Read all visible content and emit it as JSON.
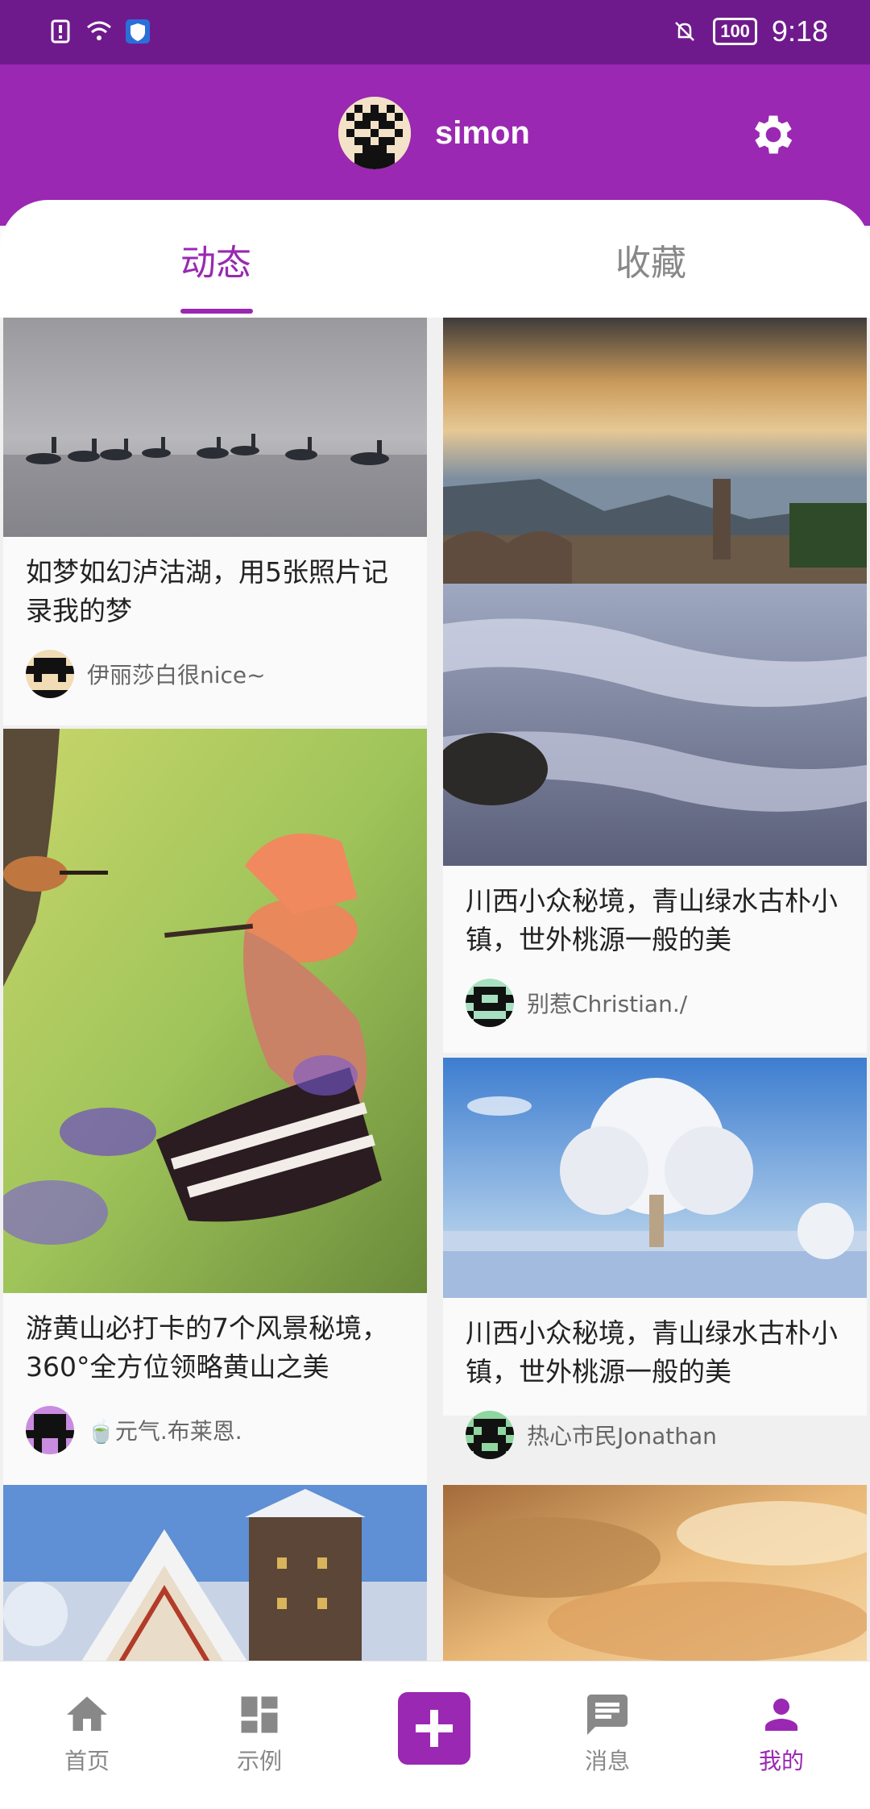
{
  "status_bar": {
    "time": "9:18",
    "battery": "100"
  },
  "header": {
    "username": "simon"
  },
  "tabs": [
    {
      "label": "动态",
      "active": true
    },
    {
      "label": "收藏",
      "active": false
    }
  ],
  "feed": {
    "cards": [
      {
        "title": "如梦如幻泸沽湖，用5张照片记录我的梦",
        "author": "伊丽莎白很nice~",
        "image": "birds-on-lake-snow"
      },
      {
        "title": "川西小众秘境，青山绿水古朴小镇，世外桃源一般的美",
        "author": "别惹Christian./",
        "image": "river-town-sunset"
      },
      {
        "title": "游黄山必打卡的7个风景秘境，360°全方位领略黄山之美",
        "author": "🍵元气.布莱恩.",
        "image": "hoopoe-birds"
      },
      {
        "title": "川西小众秘境，青山绿水古朴小镇，世外桃源一般的美",
        "author": "热心市民Jonathan",
        "image": "snowy-tree"
      },
      {
        "title": "",
        "author": "",
        "image": "snowy-houses"
      },
      {
        "title": "",
        "author": "",
        "image": "golden-clouds"
      }
    ]
  },
  "bottom_nav": [
    {
      "label": "首页",
      "icon": "home-icon"
    },
    {
      "label": "示例",
      "icon": "dashboard-icon"
    },
    {
      "label": "",
      "icon": "add-icon"
    },
    {
      "label": "消息",
      "icon": "message-icon"
    },
    {
      "label": "我的",
      "icon": "person-icon",
      "active": true
    }
  ],
  "colors": {
    "primary": "#9a28b2",
    "status_bar": "#6f1a8c"
  }
}
